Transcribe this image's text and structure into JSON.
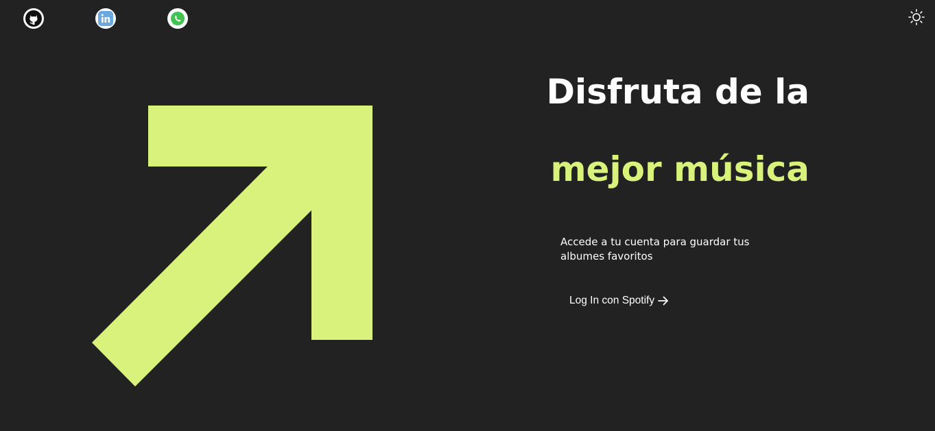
{
  "colors": {
    "background": "#222222",
    "accent": "#d8f27b",
    "text": "#ffffff"
  },
  "header": {
    "social_links": [
      {
        "name": "GitHub",
        "icon": "github-icon"
      },
      {
        "name": "LinkedIn",
        "icon": "linkedin-icon"
      },
      {
        "name": "WhatsApp",
        "icon": "whatsapp-icon"
      }
    ],
    "theme_toggle_icon": "sun-icon"
  },
  "hero": {
    "headline_line1": "Disfruta de la",
    "headline_line2": "mejor música",
    "subtitle": "Accede a tu cuenta para guardar tus albumes favoritos",
    "login_label": "Log In con Spotify",
    "login_icon": "arrow-right-icon",
    "graphic_icon": "arrow-up-right-icon"
  }
}
